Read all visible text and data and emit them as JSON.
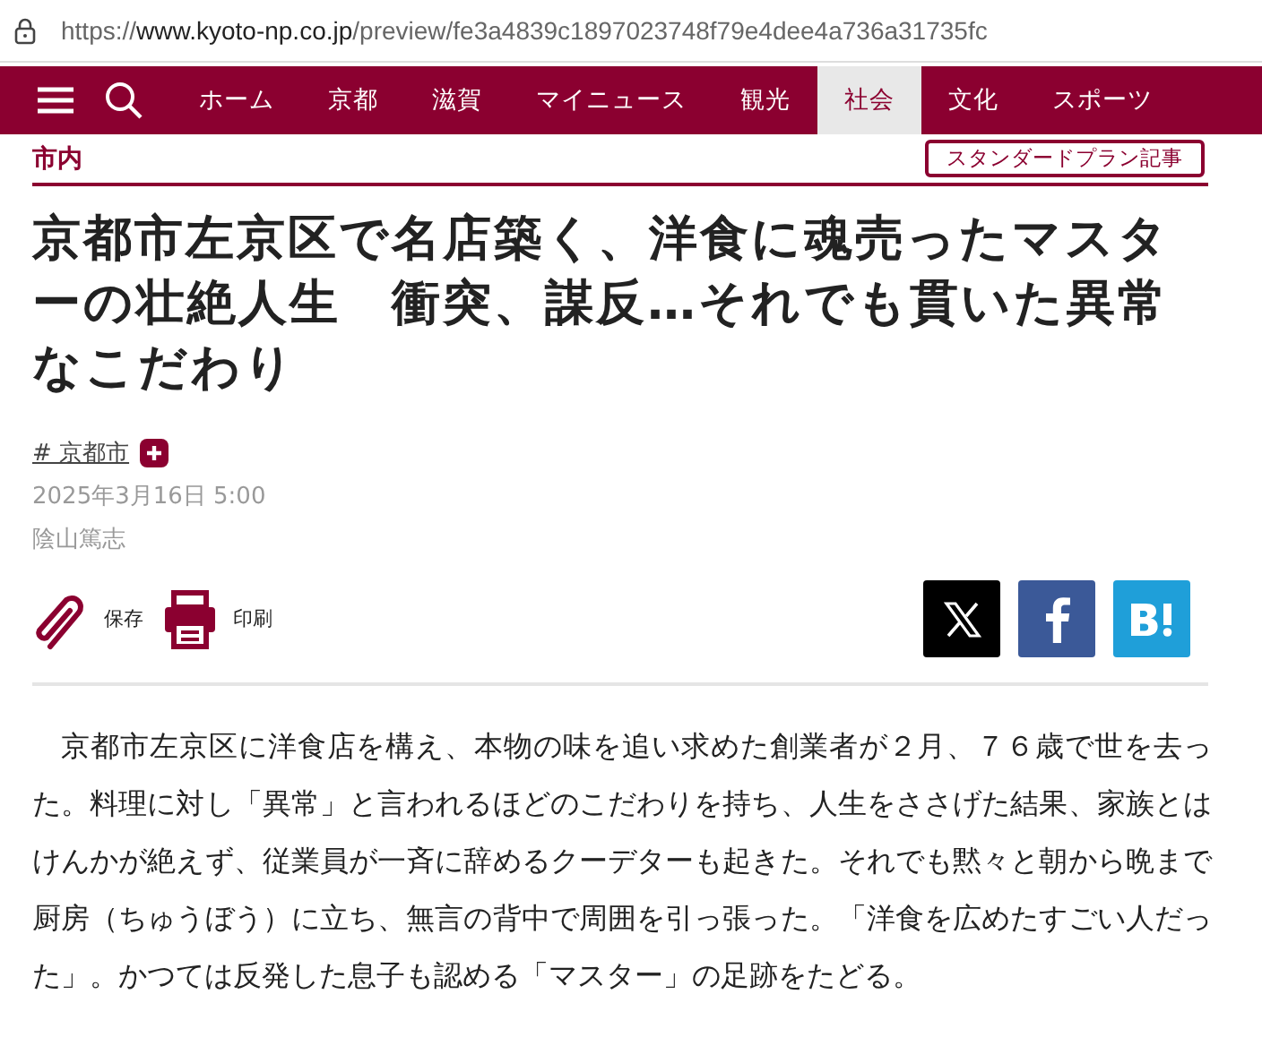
{
  "address_bar": {
    "scheme": "https://",
    "host": "www.kyoto-np.co.jp",
    "path": "/preview/fe3a4839c1897023748f79e4dee4a736a31735fc"
  },
  "nav": {
    "items": [
      {
        "label": "ホーム",
        "selected": false
      },
      {
        "label": "京都",
        "selected": false
      },
      {
        "label": "滋賀",
        "selected": false
      },
      {
        "label": "マイニュース",
        "selected": false
      },
      {
        "label": "観光",
        "selected": false
      },
      {
        "label": "社会",
        "selected": true
      },
      {
        "label": "文化",
        "selected": false
      },
      {
        "label": "スポーツ",
        "selected": false
      }
    ]
  },
  "article": {
    "category": "市内",
    "plan_badge": "スタンダードプラン記事",
    "title": "京都市左京区で名店築く、洋食に魂売ったマスターの壮絶人生　衝突、謀反…それでも貫いた異常なこだわり",
    "tag": "# 京都市",
    "date": "2025年3月16日 5:00",
    "author": "陰山篤志",
    "actions": [
      {
        "kind": "save",
        "label": "保存"
      },
      {
        "kind": "print",
        "label": "印刷"
      }
    ],
    "share": [
      {
        "kind": "x",
        "color": "#000000"
      },
      {
        "kind": "facebook",
        "color": "#3b5998"
      },
      {
        "kind": "hatena",
        "color": "#1f9fd9"
      }
    ],
    "lead": "京都市左京区に洋食店を構え、本物の味を追い求めた創業者が２月、７６歳で世を去った。料理に対し「異常」と言われるほどのこだわりを持ち、人生をささげた結果、家族とはけんかが絶えず、従業員が一斉に辞めるクーデターも起きた。それでも黙々と朝から晩まで厨房（ちゅうぼう）に立ち、無言の背中で周囲を引っ張った。「洋食を広めたすごい人だった」。かつては反発した息子も認める「マスター」の足跡をたどる。"
  }
}
